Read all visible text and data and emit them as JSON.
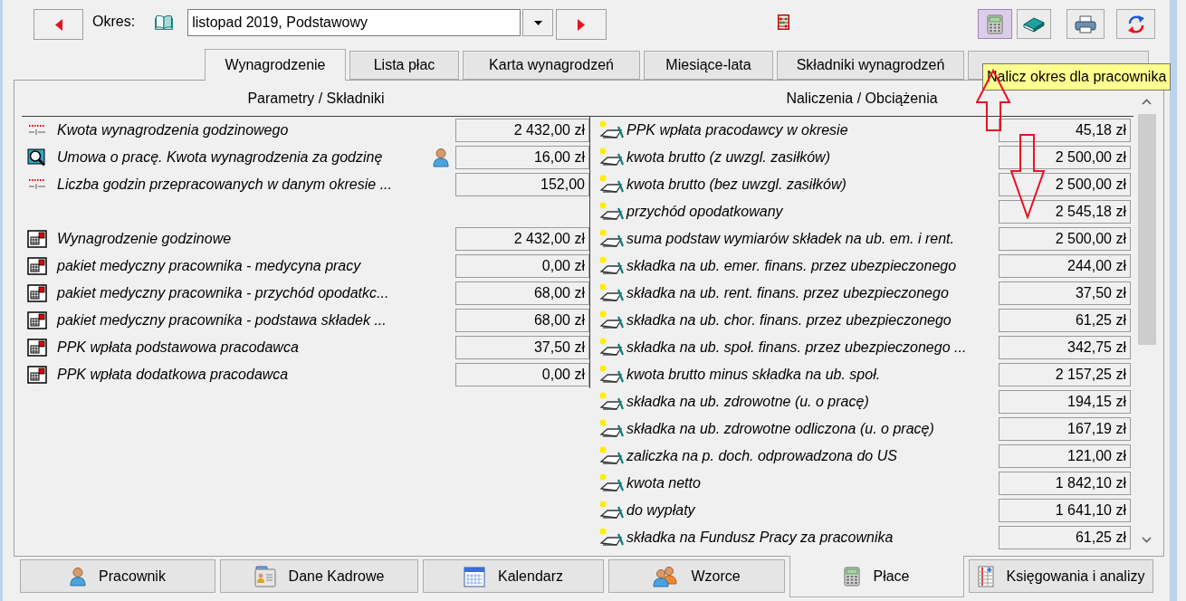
{
  "period": {
    "label": "Okres:",
    "value": "listopad 2019, Podstawowy"
  },
  "toolbar": [
    {
      "kind": "calculate",
      "highlighted": true
    },
    {
      "kind": "book",
      "highlighted": false
    },
    {
      "kind": "print",
      "highlighted": false
    },
    {
      "kind": "refresh",
      "highlighted": false
    }
  ],
  "tooltip": {
    "text": "Nalicz okres dla pracownika"
  },
  "tabs": [
    {
      "label": "Wynagrodzenie",
      "selected": true
    },
    {
      "label": "Lista płac",
      "selected": false
    },
    {
      "label": "Karta wynagrodzeń",
      "selected": false
    },
    {
      "label": "Miesiące-lata",
      "selected": false
    },
    {
      "label": "Składniki wynagrodzeń",
      "selected": false
    }
  ],
  "parameters": {
    "heading": "Parametry / Składniki",
    "groups": [
      {
        "rows": [
          {
            "kind": "parameter",
            "label": "Kwota wynagrodzenia godzinowego",
            "value": "2 432,00 zł",
            "employee_icon": false
          },
          {
            "kind": "agreement",
            "label": "Umowa o pracę. Kwota wynagrodzenia za godzinę",
            "value": "16,00 zł",
            "employee_icon": true
          },
          {
            "kind": "parameter",
            "label": "Liczba godzin przepracowanych w danym okresie ...",
            "value": "152,00",
            "employee_icon": false
          }
        ]
      },
      {
        "rows": [
          {
            "kind": "component",
            "label": "Wynagrodzenie godzinowe",
            "value": "2 432,00 zł",
            "employee_icon": false
          },
          {
            "kind": "component",
            "label": "pakiet medyczny pracownika - medycyna pracy",
            "value": "0,00 zł",
            "employee_icon": false
          },
          {
            "kind": "component",
            "label": "pakiet medyczny pracownika - przychód opodatkc...",
            "value": "68,00 zł",
            "employee_icon": false
          },
          {
            "kind": "component",
            "label": "pakiet medyczny pracownika - podstawa składek ...",
            "value": "68,00 zł",
            "employee_icon": false
          },
          {
            "kind": "component",
            "label": "PPK wpłata podstawowa pracodawca",
            "value": "37,50 zł",
            "employee_icon": false
          },
          {
            "kind": "component",
            "label": "PPK wpłata dodatkowa pracodawca",
            "value": "0,00 zł",
            "employee_icon": false
          }
        ]
      }
    ]
  },
  "charges": {
    "heading": "Naliczenia / Obciążenia",
    "rows": [
      {
        "label": "PPK wpłata pracodawcy w okresie",
        "value": "45,18 zł"
      },
      {
        "label": "kwota brutto (z uwzgl. zasiłków)",
        "value": "2 500,00 zł"
      },
      {
        "label": "kwota brutto (bez uwzgl. zasiłków)",
        "value": "2 500,00 zł"
      },
      {
        "label": "przychód opodatkowany",
        "value": "2 545,18 zł"
      },
      {
        "label": "suma podstaw wymiarów składek na ub. em. i rent.",
        "value": "2 500,00 zł"
      },
      {
        "label": "składka na ub. emer. finans. przez ubezpieczonego",
        "value": "244,00 zł"
      },
      {
        "label": "składka na ub. rent. finans. przez ubezpieczonego",
        "value": "37,50 zł"
      },
      {
        "label": "składka na ub. chor. finans. przez ubezpieczonego",
        "value": "61,25 zł"
      },
      {
        "label": "składka na ub. społ. finans. przez ubezpieczonego ...",
        "value": "342,75 zł"
      },
      {
        "label": "kwota brutto minus składka na ub. społ.",
        "value": "2 157,25 zł"
      },
      {
        "label": "składka na ub. zdrowotne (u. o pracę)",
        "value": "194,15 zł"
      },
      {
        "label": "składka na ub. zdrowotne odliczona (u. o pracę)",
        "value": "167,19 zł"
      },
      {
        "label": "zaliczka na p. doch. odprowadzona do US",
        "value": "121,00 zł"
      },
      {
        "label": "kwota netto",
        "value": "1 842,10 zł"
      },
      {
        "label": "do wypłaty",
        "value": "1 641,10 zł"
      },
      {
        "label": "składka na Fundusz Pracy za pracownika",
        "value": "61,25 zł"
      }
    ]
  },
  "bottom_tabs": [
    {
      "kind": "employee",
      "label": "Pracownik",
      "selected": false
    },
    {
      "kind": "personnel",
      "label": "Dane Kadrowe",
      "selected": false
    },
    {
      "kind": "calendar",
      "label": "Kalendarz",
      "selected": false
    },
    {
      "kind": "templates",
      "label": "Wzorce",
      "selected": false
    },
    {
      "kind": "payroll",
      "label": "Płace",
      "selected": true
    },
    {
      "kind": "accounting",
      "label": "Księgowania i analizy",
      "selected": false
    }
  ]
}
